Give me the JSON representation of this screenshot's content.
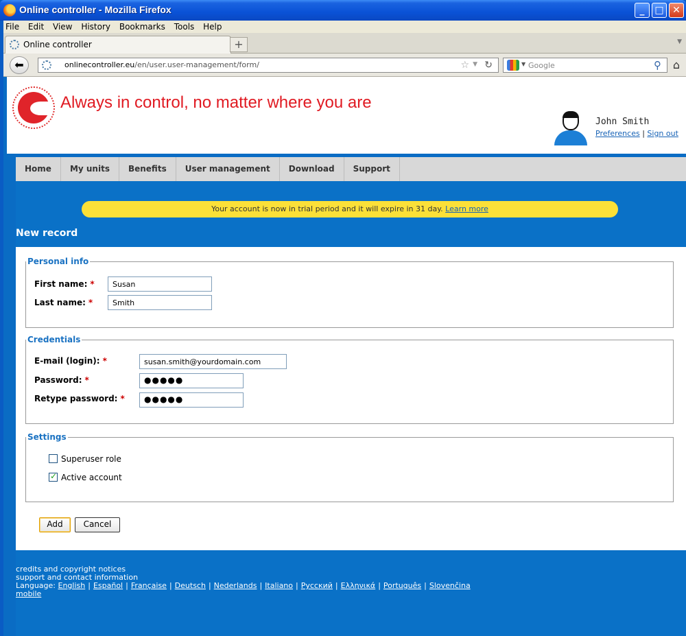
{
  "window": {
    "title": "Online controller - Mozilla Firefox"
  },
  "menu": [
    "File",
    "Edit",
    "View",
    "History",
    "Bookmarks",
    "Tools",
    "Help"
  ],
  "tab": {
    "label": "Online controller",
    "new_tab": "+"
  },
  "address": {
    "host": "onlinecontroller.eu",
    "path": "/en/user.user-management/form/"
  },
  "search": {
    "placeholder": "Google"
  },
  "header": {
    "tagline": "Always in control, no matter where you are",
    "user_name": "John Smith",
    "preferences": "Preferences",
    "link_sep": " | ",
    "sign_out": "Sign out"
  },
  "nav": [
    "Home",
    "My units",
    "Benefits",
    "User management",
    "Download",
    "Support"
  ],
  "notice": {
    "text": "Your account is now in trial period and it will expire in 31 day. ",
    "link": "Learn more"
  },
  "page_title": "New record",
  "form": {
    "personal": {
      "legend": "Personal info",
      "first_name_label": "First name:",
      "first_name_value": "Susan",
      "last_name_label": "Last name:",
      "last_name_value": "Smith"
    },
    "credentials": {
      "legend": "Credentials",
      "email_label": "E-mail (login):",
      "email_value": "susan.smith@yourdomain.com",
      "password_label": "Password:",
      "password_value": "●●●●●",
      "retype_label": "Retype password:",
      "retype_value": "●●●●●"
    },
    "settings": {
      "legend": "Settings",
      "superuser_label": "Superuser role",
      "superuser_checked": false,
      "active_label": "Active account",
      "active_checked": true
    },
    "required_mark": "*",
    "add_button": "Add",
    "cancel_button": "Cancel"
  },
  "footer": {
    "credits": "credits and copyright notices",
    "support": "support and contact information",
    "language_label": "Language:",
    "languages": [
      "English",
      "Español",
      "Française",
      "Deutsch",
      "Nederlands",
      "Italiano",
      "Русский",
      "Ελληνικά",
      "Português",
      "Slovenčina"
    ],
    "lang_sep": "|",
    "mobile": "mobile"
  },
  "colors": {
    "brand_red": "#e01a22",
    "page_blue": "#0a71c7",
    "notice_yellow": "#fbe038",
    "legend_blue": "#1a72c2"
  },
  "icons": [
    "firefox-icon",
    "back-arrow-icon",
    "site-favicon",
    "bookmark-star-icon",
    "reload-icon",
    "google-icon",
    "search-icon",
    "home-icon",
    "user-avatar-icon"
  ]
}
